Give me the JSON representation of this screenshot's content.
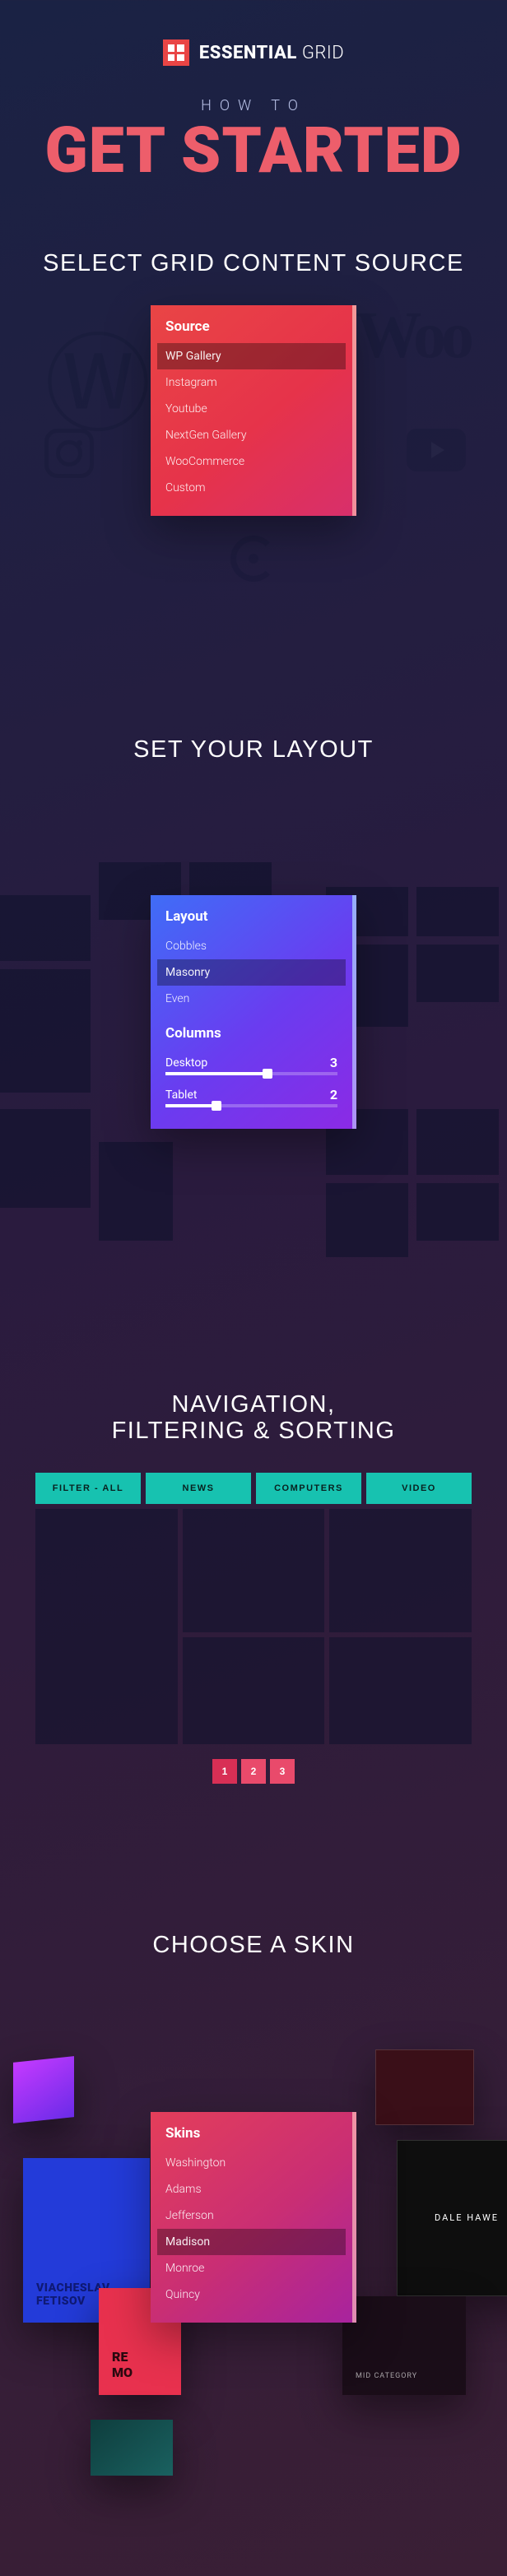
{
  "brand": {
    "name_bold": "ESSENTIAL",
    "name_light": "GRID"
  },
  "hero": {
    "kicker": "HOW TO",
    "title": "GET STARTED"
  },
  "section1": {
    "heading": "SELECT GRID CONTENT SOURCE",
    "panel_title": "Source",
    "items": [
      "WP Gallery",
      "Instagram",
      "Youtube",
      "NextGen Gallery",
      "WooCommerce",
      "Custom"
    ],
    "selected": "WP Gallery"
  },
  "section2": {
    "heading": "SET YOUR LAYOUT",
    "panel_title": "Layout",
    "items": [
      "Cobbles",
      "Masonry",
      "Even"
    ],
    "selected": "Masonry",
    "columns_title": "Columns",
    "columns": [
      {
        "label": "Desktop",
        "value": "3",
        "pct": 60
      },
      {
        "label": "Tablet",
        "value": "2",
        "pct": 30
      }
    ]
  },
  "section3": {
    "heading_line1": "NAVIGATION,",
    "heading_line2": "FILTERING & SORTING",
    "filters": [
      "FILTER - ALL",
      "NEWS",
      "COMPUTERS",
      "VIDEO"
    ],
    "pages": [
      "1",
      "2",
      "3"
    ],
    "active_page": "1"
  },
  "section4": {
    "heading": "CHOOSE A SKIN",
    "panel_title": "Skins",
    "items": [
      "Washington",
      "Adams",
      "Jefferson",
      "Madison",
      "Monroe",
      "Quincy"
    ],
    "selected": "Madison",
    "cards": {
      "blue_title": "VIACHESLAV FETISOV",
      "red2_line1": "RE",
      "red2_line2": "MO",
      "black_title": "DALE HAWE",
      "dark_tag": "MID CATEGORY"
    }
  }
}
